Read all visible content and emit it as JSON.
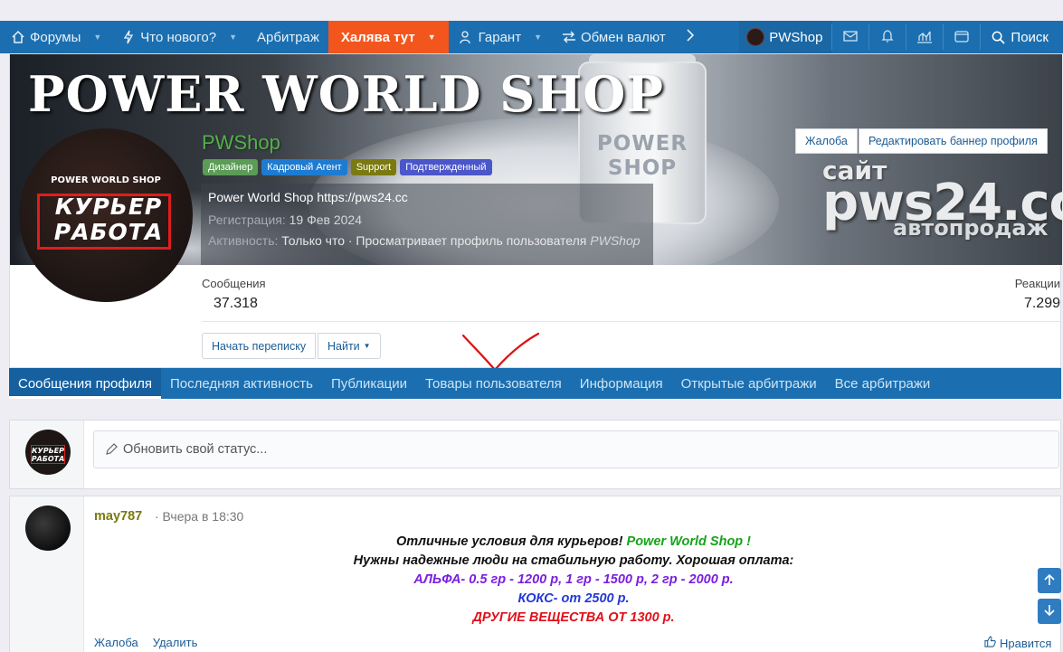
{
  "nav": {
    "items": [
      {
        "label": "Форумы",
        "icon": "home-icon",
        "caret": true
      },
      {
        "label": "Что нового?",
        "icon": "lightning-icon",
        "caret": true
      },
      {
        "label": "Арбитраж",
        "icon": "",
        "caret": false
      },
      {
        "label": "Халява тут",
        "icon": "",
        "caret": true,
        "highlight": "#f2561d"
      },
      {
        "label": "Гарант",
        "icon": "user-key-icon",
        "caret": true
      },
      {
        "label": "Обмен валют",
        "icon": "exchange-arrows-icon",
        "caret": false
      }
    ],
    "more_icon": "chevron-right-icon",
    "user_name": "PWShop",
    "search_label": "Поиск"
  },
  "profile": {
    "banner_headline": "POWER WORLD SHOP",
    "banner_jar_label": "POWER SHOP",
    "banner_site_1": "сайт",
    "banner_site_2": "pws24.cc",
    "banner_site_3": "автопродаж",
    "avatar_brand": "POWER WORLD SHOP",
    "avatar_word_1": "КУРЬЕР",
    "avatar_word_2": "РАБОТА",
    "username": "PWShop",
    "badges": [
      {
        "label": "Дизайнер",
        "color": "#5b9c56"
      },
      {
        "label": "Кадровый Агент",
        "color": "#1e7bd1"
      },
      {
        "label": "Support",
        "color": "#7a7a10"
      },
      {
        "label": "Подтвержденный",
        "color": "#4a56c9"
      }
    ],
    "bio": "Power World Shop https://pws24.cc",
    "registration_label": "Регистрация:",
    "registration_date": "19 Фев 2024",
    "activity_label": "Активность:",
    "activity_text": "Только что · Просматривает профиль пользователя",
    "activity_target": "PWShop",
    "report_label": "Жалоба",
    "edit_banner_label": "Редактировать баннер профиля",
    "messages_label": "Сообщения",
    "messages_value": "37.318",
    "reactions_label": "Реакции",
    "reactions_value": "7.299",
    "start_conversation_label": "Начать переписку",
    "find_label": "Найти"
  },
  "tabs": [
    {
      "label": "Сообщения профиля",
      "active": true
    },
    {
      "label": "Последняя активность",
      "active": false
    },
    {
      "label": "Публикации",
      "active": false
    },
    {
      "label": "Товары пользователя",
      "active": false
    },
    {
      "label": "Информация",
      "active": false
    },
    {
      "label": "Открытые арбитражи",
      "active": false
    },
    {
      "label": "Все арбитражи",
      "active": false
    }
  ],
  "status": {
    "placeholder": "Обновить свой статус..."
  },
  "post": {
    "author": "may787",
    "time": "· Вчера в 18:30",
    "line1_a": "Отличные условия для курьеров!",
    "line1_b": "Power World Shop !",
    "line2": "Нужны надежные люди на стабильную работу. Хорошая оплата:",
    "line3": "АЛЬФА- 0.5 гр - 1200 р, 1 гр - 1500 р, 2 гр - 2000 р.",
    "line4": "КОКС- от 2500 р.",
    "line5": "ДРУГИЕ ВЕЩЕСТВА ОТ 1300 р.",
    "report_label": "Жалоба",
    "delete_label": "Удалить",
    "like_label": "Нравится"
  },
  "colors": {
    "nav_bg": "#1b6fb0",
    "hot_tab": "#f2561d",
    "username_green": "#52b04a",
    "annotation_red": "#e01010"
  }
}
